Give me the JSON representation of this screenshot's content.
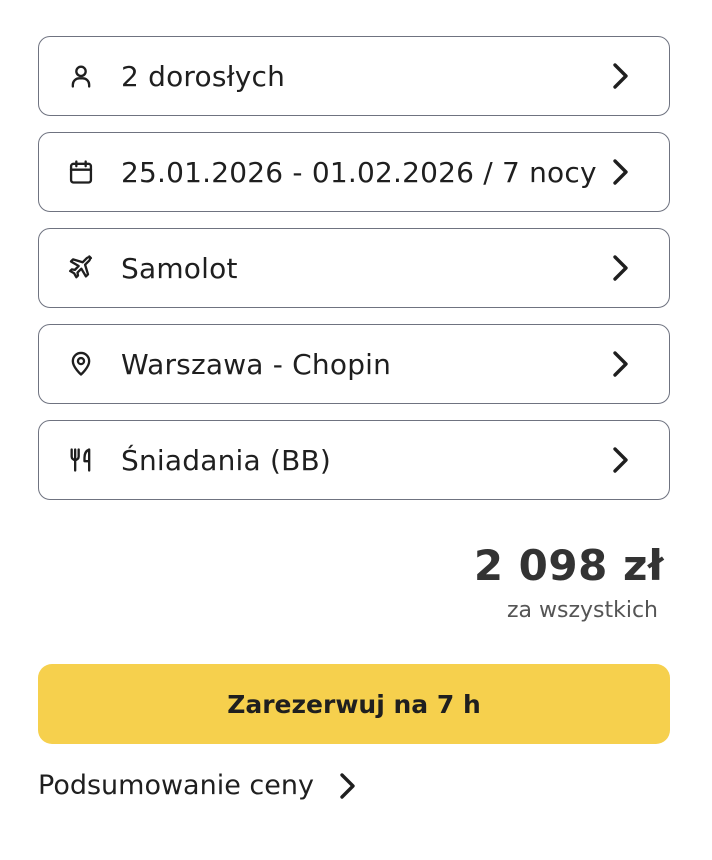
{
  "options": [
    {
      "icon": "person-icon",
      "label": "2 dorosłych"
    },
    {
      "icon": "calendar-icon",
      "label": "25.01.2026 - 01.02.2026 / 7 nocy"
    },
    {
      "icon": "airplane-icon",
      "label": "Samolot"
    },
    {
      "icon": "location-pin-icon",
      "label": "Warszawa - Chopin"
    },
    {
      "icon": "fork-knife-icon",
      "label": "Śniadania (BB)"
    }
  ],
  "price": {
    "amount": "2 098 zł",
    "note": "za wszystkich"
  },
  "book_button": {
    "label": "Zarezerwuj na 7 h"
  },
  "summary_link": {
    "label": "Podsumowanie ceny"
  },
  "colors": {
    "accent": "#f6d04d",
    "border": "#6f7380",
    "text": "#1f1f1f"
  }
}
